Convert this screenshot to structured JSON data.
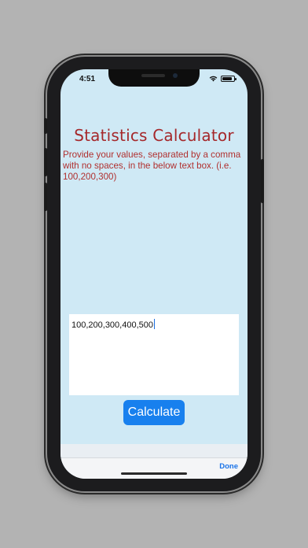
{
  "status_bar": {
    "time": "4:51"
  },
  "app": {
    "title": "Statistics Calculator",
    "instructions": "Provide your values, separated by a comma with no spaces, in the below text box. (i.e. 100,200,300)",
    "input_value": "100,200,300,400,500",
    "calculate_label": "Calculate"
  },
  "keyboard_bar": {
    "done_label": "Done"
  },
  "colors": {
    "background": "#cfe9f5",
    "title": "#a5282b",
    "button": "#1880ee",
    "done": "#1a73e8"
  }
}
